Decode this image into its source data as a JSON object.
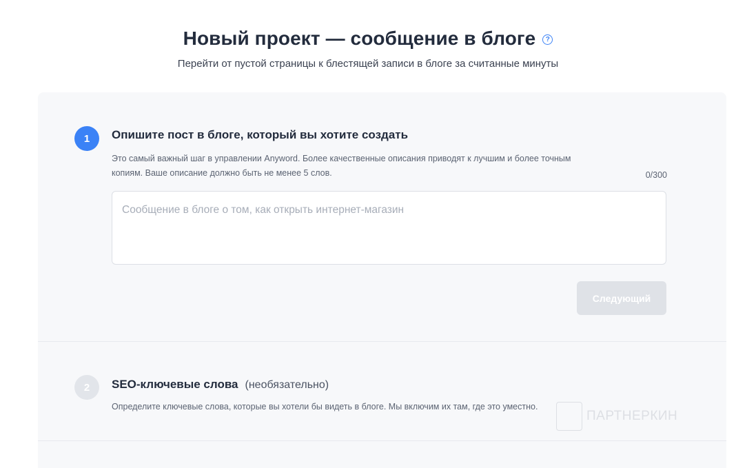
{
  "header": {
    "title": "Новый проект — сообщение в блоге",
    "help_icon": "?",
    "subtitle": "Перейти от пустой страницы к блестящей записи в блоге за считанные минуты"
  },
  "steps": [
    {
      "number": "1",
      "title": "Опишите пост в блоге, который вы хотите создать",
      "description_line1": "Это самый важный шаг в управлении Anyword. Более качественные описания приводят к лучшим и более точным",
      "description_line2": "копиям. Ваше описание должно быть не менее 5 слов.",
      "counter": "0/300",
      "textarea_value": "",
      "textarea_placeholder": "Сообщение в блоге о том, как открыть интернет-магазин",
      "next_label": "Следующий"
    },
    {
      "number": "2",
      "title": "SEO-ключевые слова",
      "optional": "(необязательно)",
      "description": "Определите ключевые слова, которые вы хотели бы видеть в блоге. Мы включим их там, где это уместно."
    }
  ],
  "watermark": {
    "text": "ПАРТНЕРКИН"
  },
  "colors": {
    "accent": "#3b82f6",
    "card_bg": "#f7f8fa",
    "disabled_button": "#dfe2e7"
  }
}
